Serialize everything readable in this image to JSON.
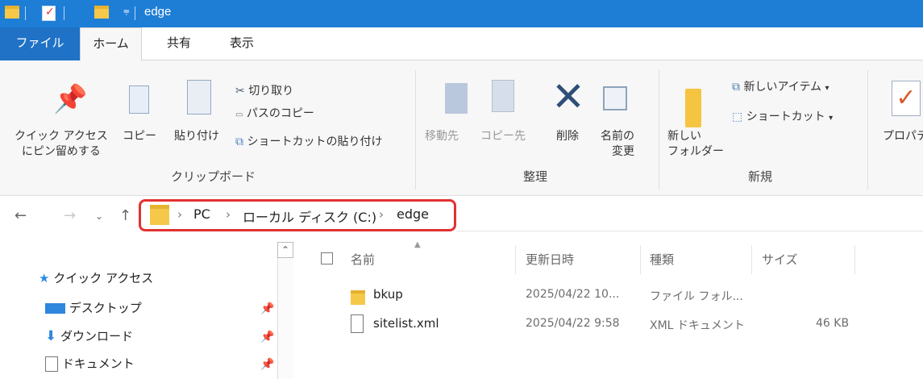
{
  "window": {
    "title": "edge"
  },
  "tabs": [
    "ファイル",
    "ホーム",
    "共有",
    "表示"
  ],
  "ribbon": {
    "clipboard": {
      "pin_label_1": "クイック アクセス",
      "pin_label_2": "にピン留めする",
      "copy": "コピー",
      "paste": "貼り付け",
      "cut": "切り取り",
      "copy_path": "パスのコピー",
      "paste_shortcut": "ショートカットの貼り付け",
      "group": "クリップボード"
    },
    "organize": {
      "move_to": "移動先",
      "copy_to": "コピー先",
      "delete": "削除",
      "rename_1": "名前の",
      "rename_2": "変更",
      "group": "整理"
    },
    "new": {
      "new_folder_1": "新しい",
      "new_folder_2": "フォルダー",
      "new_item": "新しいアイテム",
      "shortcut": "ショートカット",
      "group": "新規",
      "properties_partial": "プロパテ"
    }
  },
  "address": {
    "pc": "PC",
    "disk": "ローカル ディスク (C:)",
    "folder": "edge"
  },
  "nav": {
    "quick_access": "クイック アクセス",
    "desktop": "デスクトップ",
    "downloads": "ダウンロード",
    "documents": "ドキュメント"
  },
  "columns": {
    "name": "名前",
    "modified": "更新日時",
    "type": "種類",
    "size": "サイズ"
  },
  "files": [
    {
      "name": "bkup",
      "modified": "2025/04/22 10...",
      "type": "ファイル フォル...",
      "size": ""
    },
    {
      "name": "sitelist.xml",
      "modified": "2025/04/22 9:58",
      "type": "XML ドキュメント",
      "size": "46 KB"
    }
  ],
  "colors": {
    "titlebar": "#1e7ed6",
    "file_tab": "#1f72c6",
    "highlight_box": "#e23131",
    "folder": "#f6c84a"
  }
}
